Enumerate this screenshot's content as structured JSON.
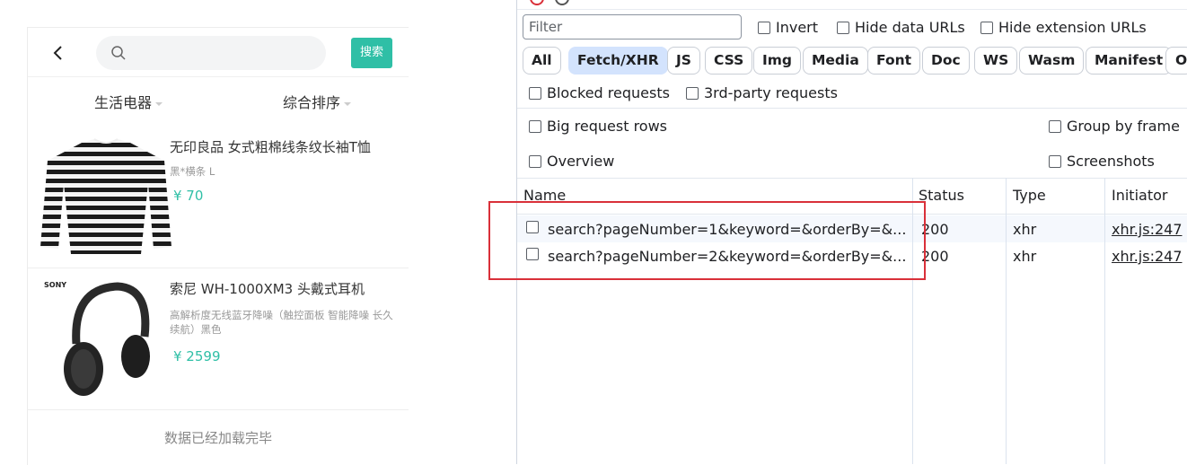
{
  "app": {
    "search_button": "搜索",
    "filters": [
      "生活电器",
      "综合排序"
    ],
    "products": [
      {
        "title": "无印良品 女式粗棉线条纹长袖T恤",
        "desc": "黑*横条 L",
        "price": "¥ 70",
        "image": "striped-shirt"
      },
      {
        "title": "索尼 WH-1000XM3 头戴式耳机",
        "desc": "高解析度无线蓝牙降噪（触控面板 智能降噪 长久续航）黑色",
        "price": "¥ 2599",
        "image": "headphones",
        "brand_mark": "SONY"
      }
    ],
    "footer_text": "数据已经加载完毕"
  },
  "devtools": {
    "filter_placeholder": "Filter",
    "checkboxes_top": [
      "Invert",
      "Hide data URLs",
      "Hide extension URLs"
    ],
    "type_filters": [
      "All",
      "Fetch/XHR",
      "JS",
      "CSS",
      "Img",
      "Media",
      "Font",
      "Doc",
      "WS",
      "Wasm",
      "Manifest",
      "O"
    ],
    "active_filter": "Fetch/XHR",
    "checkboxes_row2": [
      "Blocked requests",
      "3rd-party requests"
    ],
    "options": {
      "big_request_rows": "Big request rows",
      "group_by_frame": "Group by frame",
      "overview": "Overview",
      "screenshots": "Screenshots"
    },
    "columns": [
      "Name",
      "Status",
      "Type",
      "Initiator"
    ],
    "requests": [
      {
        "name": "search?pageNumber=1&keyword=&orderBy=&...",
        "status": "200",
        "type": "xhr",
        "initiator": "xhr.js:247"
      },
      {
        "name": "search?pageNumber=2&keyword=&orderBy=&...",
        "status": "200",
        "type": "xhr",
        "initiator": "xhr.js:247"
      }
    ],
    "highlight_color": "#d93039",
    "accent_color": "#d3e3fd"
  },
  "colors": {
    "brand": "#2fbfa6"
  }
}
